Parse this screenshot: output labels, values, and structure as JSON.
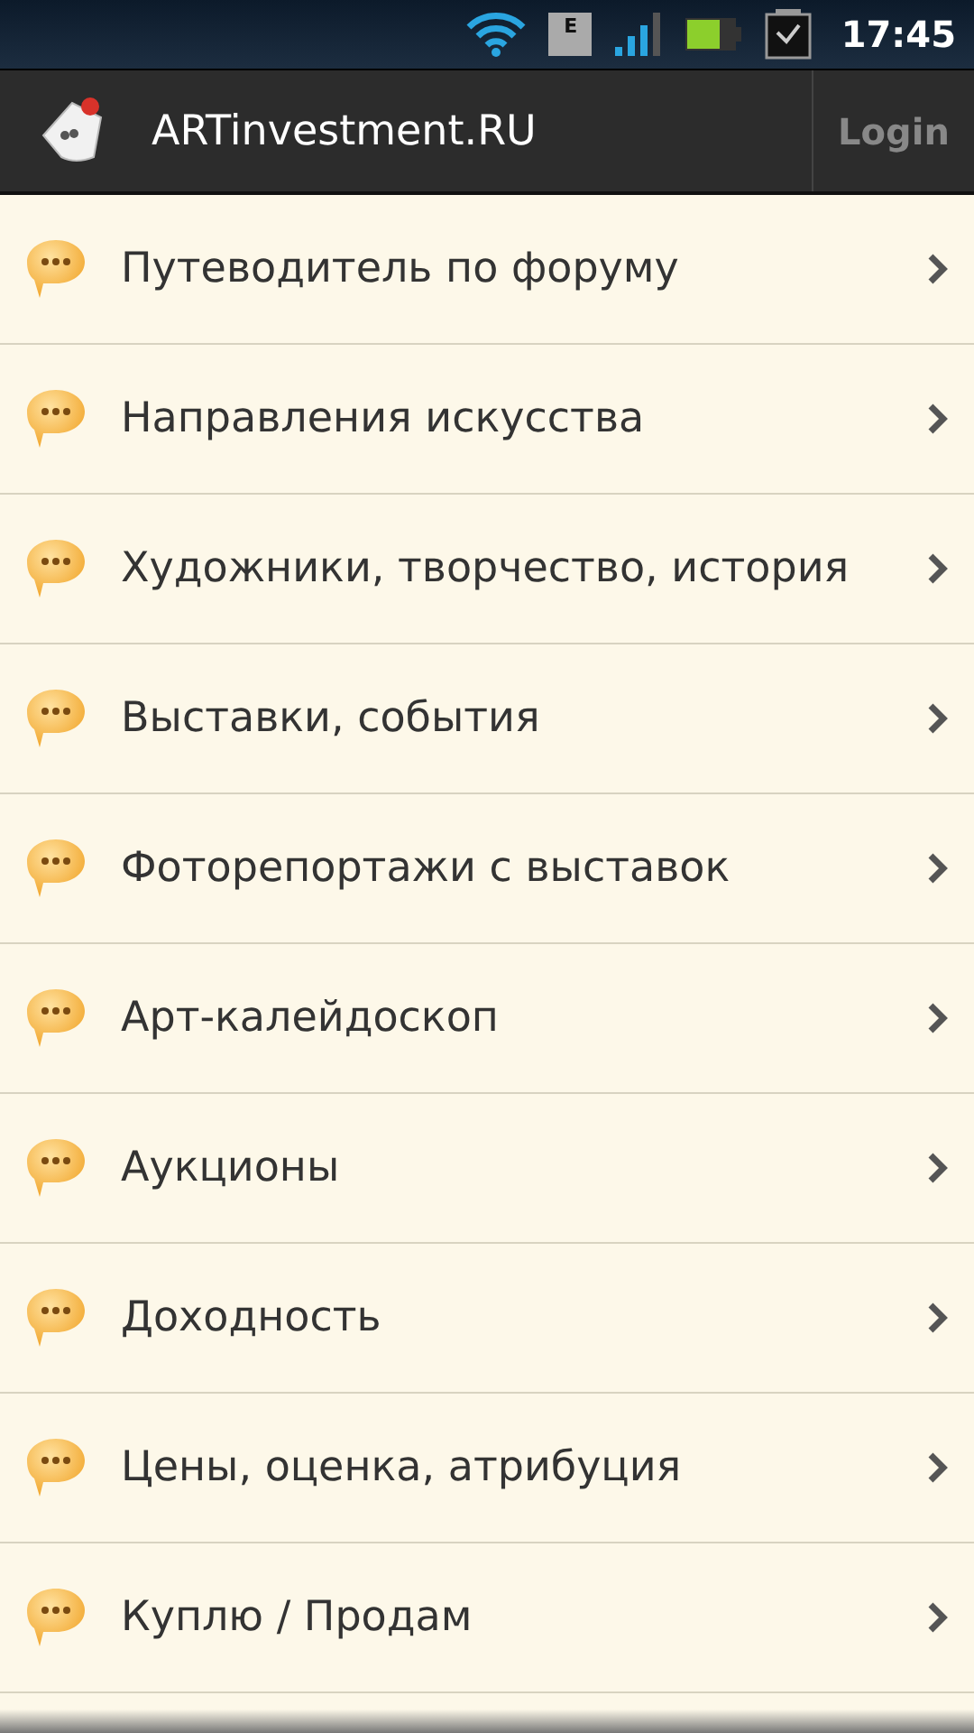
{
  "status_bar": {
    "time": "17:45",
    "network_badge": "E"
  },
  "app_bar": {
    "title": "ARTinvestment.RU",
    "login_button": "Login"
  },
  "forums": [
    {
      "title": "Путеводитель по форуму"
    },
    {
      "title": "Направления искусства"
    },
    {
      "title": "Художники, творчество, история"
    },
    {
      "title": "Выставки, события"
    },
    {
      "title": "Фоторепортажи с выставок"
    },
    {
      "title": "Арт-калейдоскоп"
    },
    {
      "title": "Аукционы"
    },
    {
      "title": "Доходность"
    },
    {
      "title": "Цены, оценка, атрибуция"
    },
    {
      "title": "Куплю / Продам"
    }
  ]
}
